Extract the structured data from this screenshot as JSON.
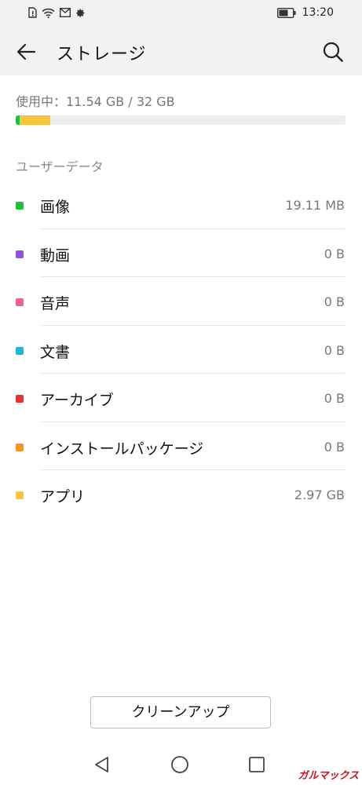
{
  "status_bar": {
    "time": "13:20",
    "icons": [
      "sim-icon",
      "wifi-icon",
      "mail-icon",
      "gear-icon",
      "battery-icon"
    ]
  },
  "header": {
    "title": "ストレージ",
    "back_icon": "arrow-left-icon",
    "search_icon": "search-icon"
  },
  "usage": {
    "text": "使用中：11.54 GB / 32 GB",
    "used_fraction": 0.3606,
    "segments": [
      {
        "name": "画像",
        "color": "#1fc13a",
        "fraction": 0.012
      },
      {
        "name": "アプリ",
        "color": "#f8c43a",
        "fraction": 0.093
      }
    ]
  },
  "section_title": "ユーザーデータ",
  "items": [
    {
      "label": "画像",
      "value": "19.11 MB",
      "color": "#1fc13a"
    },
    {
      "label": "動画",
      "value": "0 B",
      "color": "#8c52e6"
    },
    {
      "label": "音声",
      "value": "0 B",
      "color": "#f0609a"
    },
    {
      "label": "文書",
      "value": "0 B",
      "color": "#1cb7d4"
    },
    {
      "label": "アーカイブ",
      "value": "0 B",
      "color": "#ec2f2f"
    },
    {
      "label": "インストールパッケージ",
      "value": "0 B",
      "color": "#f7931e"
    },
    {
      "label": "アプリ",
      "value": "2.97 GB",
      "color": "#f8c43a"
    }
  ],
  "cleanup_button": "クリーンアップ",
  "nav": {
    "back": "nav-back-icon",
    "home": "nav-home-icon",
    "recent": "nav-recent-icon"
  },
  "watermark": "ガルマックス"
}
